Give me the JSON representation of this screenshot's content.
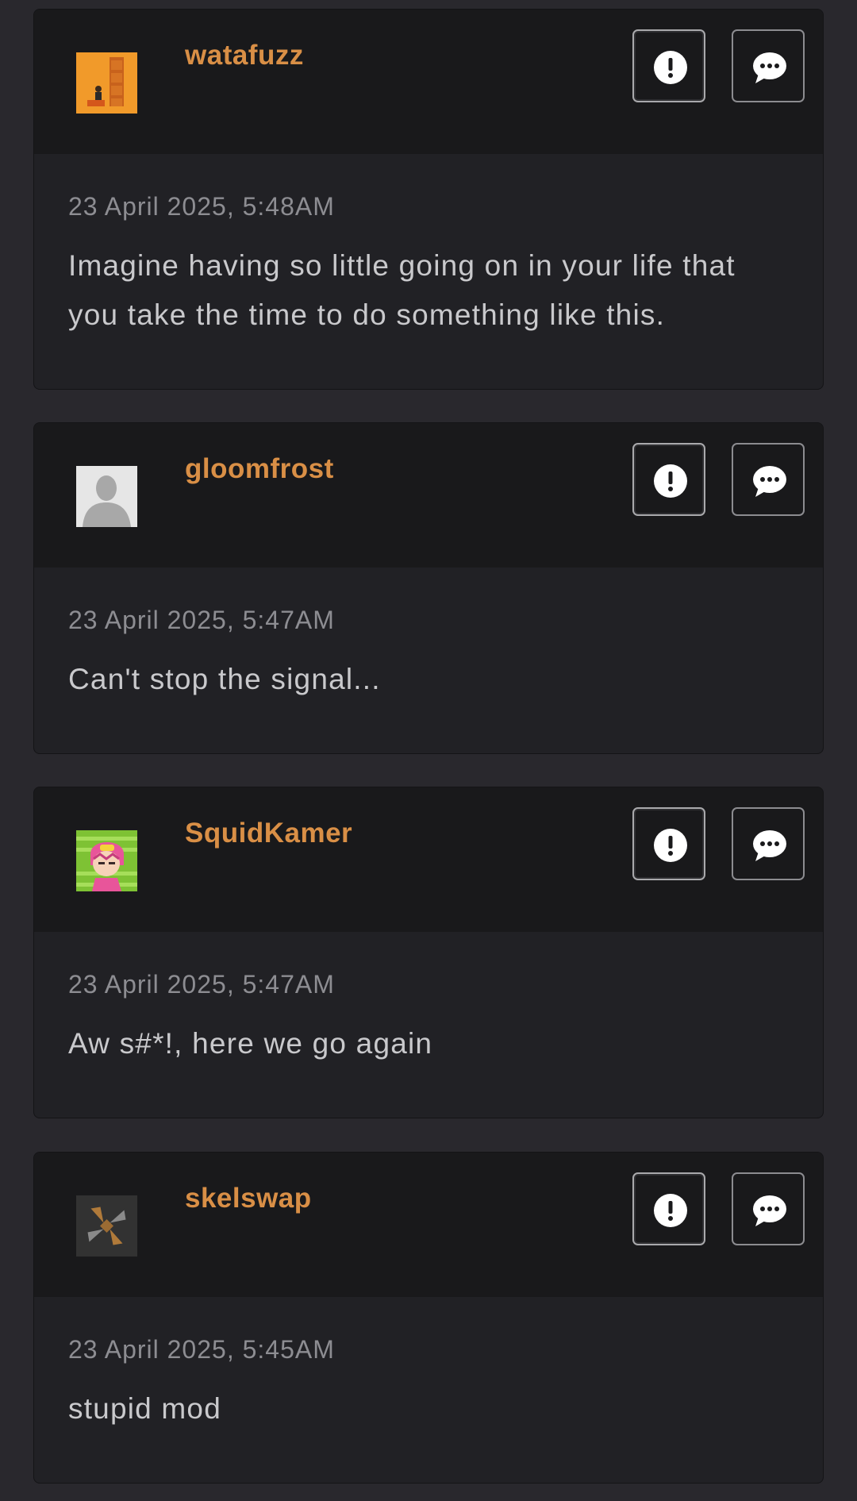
{
  "comments": [
    {
      "username": "watafuzz",
      "timestamp": "23 April 2025, 5:48AM",
      "message": "Imagine having so little going on in your life that you take the time to do something like this.",
      "avatar": "orange-album-avatar"
    },
    {
      "username": "gloomfrost",
      "timestamp": "23 April 2025, 5:47AM",
      "message": "Can't stop the signal...",
      "avatar": "default-silhouette-avatar"
    },
    {
      "username": "SquidKamer",
      "timestamp": "23 April 2025, 5:47AM",
      "message": "Aw s#*!, here we go again",
      "avatar": "anime-character-avatar"
    },
    {
      "username": "skelswap",
      "timestamp": "23 April 2025, 5:45AM",
      "message": "stupid mod",
      "avatar": "pinwheel-logo-avatar"
    }
  ],
  "icons": {
    "report": "exclamation-circle-icon",
    "reply": "speech-bubble-icon"
  },
  "colors": {
    "page_background": "#29282d",
    "card_background": "#212125",
    "header_background": "#19191b",
    "username": "#d98f46",
    "timestamp": "#8d8d92",
    "message": "#c9c9cc"
  }
}
